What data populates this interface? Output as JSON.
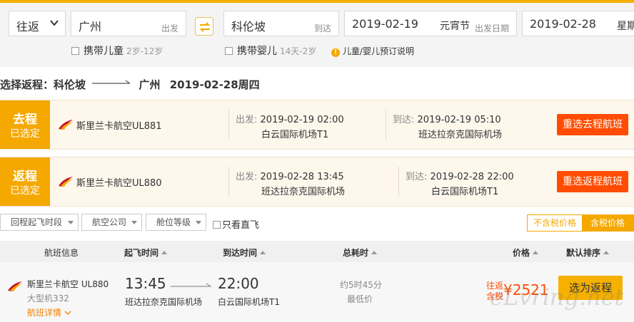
{
  "search": {
    "trip_type": "往返",
    "from_city": "广州",
    "from_hint": "出发",
    "to_city": "科伦坡",
    "to_hint": "到达",
    "depart_date": "2019-02-19",
    "depart_holiday": "元宵节",
    "depart_hint": "出发日期",
    "return_date": "2019-02-28",
    "return_weekday": "星期",
    "child_label": "携带儿童",
    "child_age": "2岁-12岁",
    "infant_label": "携带婴儿",
    "infant_age": "14天-2岁",
    "info_text": "儿童/婴儿预订说明"
  },
  "heading": {
    "prefix": "选择返程：科伦坡",
    "to": "广州",
    "date": "2019-02-28周四"
  },
  "outbound": {
    "badge_top": "去程",
    "badge_bottom": "已选定",
    "airline": "斯里兰卡航空UL881",
    "dep_label": "出发:",
    "dep_time": "2019-02-19 02:00",
    "dep_airport": "白云国际机场T1",
    "arr_label": "到达:",
    "arr_time": "2019-02-19 05:10",
    "arr_airport": "班达拉奈克国际机场",
    "button": "重选去程航班"
  },
  "return": {
    "badge_top": "返程",
    "badge_bottom": "已选定",
    "airline": "斯里兰卡航空UL880",
    "dep_label": "出发:",
    "dep_time": "2019-02-28 13:45",
    "dep_airport": "班达拉奈克国际机场",
    "arr_label": "到达:",
    "arr_time": "2019-02-28 22:00",
    "arr_airport": "白云国际机场T1",
    "button": "重选返程航班"
  },
  "filters": {
    "departure_period": "回程起飞时段",
    "airline": "航空公司",
    "cabin": "舱位等级",
    "direct_only": "只看直飞",
    "price_excl_tax": "不含税价格",
    "price_incl_tax": "含税价格"
  },
  "table": {
    "headers": {
      "flight_info": "航班信息",
      "dep_time": "起飞时间",
      "arr_time": "到达时间",
      "duration": "总耗时",
      "price": "价格",
      "sort": "默认排序"
    },
    "row": {
      "airline": "斯里兰卡航空 UL880",
      "model": "大型机332",
      "detail": "航班详情",
      "dep_time": "13:45",
      "dep_airport": "班达拉奈克国际机场",
      "arr_time": "22:00",
      "arr_airport": "白云国际机场T1",
      "duration": "约5时45分",
      "low_tag": "最低价",
      "price_label1": "往返",
      "price_label2": "含税",
      "price": "¥2521",
      "select_button": "选为返程"
    }
  },
  "watermark": "eLvring.net",
  "colors": {
    "accent": "#f5a800",
    "action": "#ff4c00"
  }
}
